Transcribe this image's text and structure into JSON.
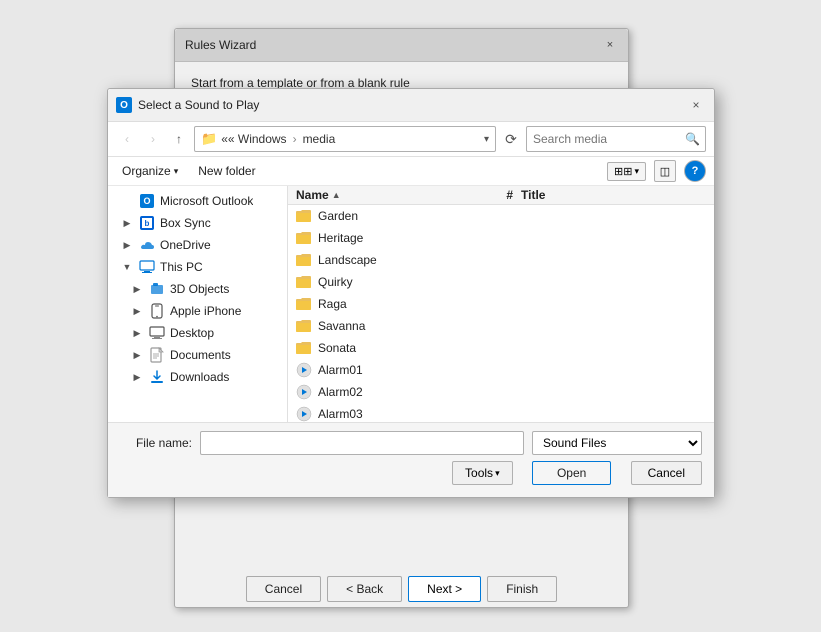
{
  "rulesWizard": {
    "title": "Rules Wizard",
    "description": "Start from a template or from a blank rule",
    "closeLabel": "×"
  },
  "fileDialog": {
    "title": "Select a Sound to Play",
    "closeLabel": "×",
    "toolbar": {
      "backLabel": "‹",
      "forwardLabel": "›",
      "upLabel": "↑",
      "addressParts": [
        "Windows",
        "media"
      ],
      "searchPlaceholder": "Search media",
      "refreshLabel": "⟳"
    },
    "secondaryToolbar": {
      "organizeLabel": "Organize",
      "newFolderLabel": "New folder",
      "viewLabel": "⊞",
      "previewLabel": "◫",
      "helpLabel": "?"
    },
    "leftNav": {
      "items": [
        {
          "id": "outlook",
          "label": "Microsoft Outlook",
          "icon": "outlook",
          "level": 0,
          "expandable": false
        },
        {
          "id": "boxsync",
          "label": "Box Sync",
          "icon": "box",
          "level": 0,
          "expandable": true,
          "expanded": false
        },
        {
          "id": "onedrive",
          "label": "OneDrive",
          "icon": "onedrive",
          "level": 0,
          "expandable": true,
          "expanded": false
        },
        {
          "id": "thispc",
          "label": "This PC",
          "icon": "pc",
          "level": 0,
          "expandable": true,
          "expanded": true
        },
        {
          "id": "3dobjects",
          "label": "3D Objects",
          "icon": "folder",
          "level": 1,
          "expandable": true,
          "expanded": false
        },
        {
          "id": "iphone",
          "label": "Apple iPhone",
          "icon": "phone",
          "level": 1,
          "expandable": true,
          "expanded": false
        },
        {
          "id": "desktop",
          "label": "Desktop",
          "icon": "folder",
          "level": 1,
          "expandable": true,
          "expanded": false
        },
        {
          "id": "documents",
          "label": "Documents",
          "icon": "docs",
          "level": 1,
          "expandable": true,
          "expanded": false
        },
        {
          "id": "downloads",
          "label": "Downloads",
          "icon": "downloads",
          "level": 1,
          "expandable": true,
          "expanded": false
        }
      ]
    },
    "fileList": {
      "columns": [
        {
          "id": "name",
          "label": "Name",
          "sortable": true
        },
        {
          "id": "hash",
          "label": "#"
        },
        {
          "id": "title",
          "label": "Title"
        }
      ],
      "items": [
        {
          "id": "garden",
          "name": "Garden",
          "type": "folder",
          "hash": "",
          "title": ""
        },
        {
          "id": "heritage",
          "name": "Heritage",
          "type": "folder",
          "hash": "",
          "title": ""
        },
        {
          "id": "landscape",
          "name": "Landscape",
          "type": "folder",
          "hash": "",
          "title": ""
        },
        {
          "id": "quirky",
          "name": "Quirky",
          "type": "folder",
          "hash": "",
          "title": ""
        },
        {
          "id": "raga",
          "name": "Raga",
          "type": "folder",
          "hash": "",
          "title": ""
        },
        {
          "id": "savanna",
          "name": "Savanna",
          "type": "folder",
          "hash": "",
          "title": ""
        },
        {
          "id": "sonata",
          "name": "Sonata",
          "type": "folder",
          "hash": "",
          "title": ""
        },
        {
          "id": "alarm01",
          "name": "Alarm01",
          "type": "sound",
          "hash": "",
          "title": ""
        },
        {
          "id": "alarm02",
          "name": "Alarm02",
          "type": "sound",
          "hash": "",
          "title": ""
        },
        {
          "id": "alarm03",
          "name": "Alarm03",
          "type": "sound",
          "hash": "",
          "title": ""
        }
      ]
    },
    "footer": {
      "fileNameLabel": "File name:",
      "fileNameValue": "",
      "fileTypeLabel": "Sound Files",
      "toolsLabel": "Tools",
      "openLabel": "Open",
      "cancelLabel": "Cancel"
    }
  },
  "wizardButtons": {
    "cancelLabel": "Cancel",
    "backLabel": "< Back",
    "nextLabel": "Next >",
    "finishLabel": "Finish"
  }
}
